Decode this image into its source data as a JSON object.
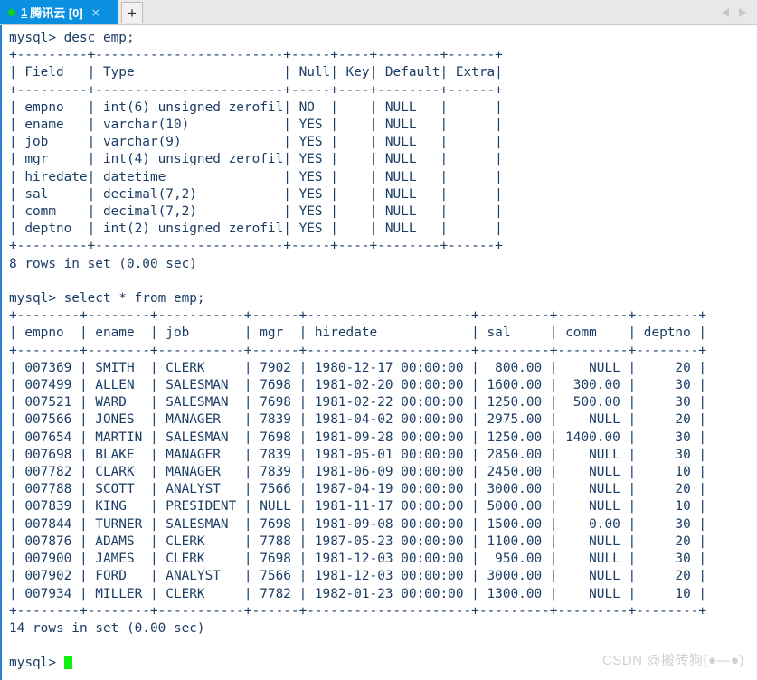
{
  "window": {
    "tab": {
      "index": "1",
      "title": "腾讯云 [0]",
      "status_dot": "green",
      "close_glyph": "×"
    },
    "new_tab_label": "+",
    "nav_prev_glyph": "◀",
    "nav_next_glyph": "▶"
  },
  "terminal": {
    "prompt": "mysql> ",
    "command_1": "desc emp;",
    "command_2": "select * from emp;",
    "final_prompt": "mysql> ",
    "result_1_footer": "8 rows in set (0.00 sec)",
    "result_2_footer": "14 rows in set (0.00 sec)",
    "desc_table": {
      "headers": [
        "Field",
        "Type",
        "Null",
        "Key",
        "Default",
        "Extra"
      ],
      "widths": [
        9,
        24,
        5,
        4,
        8,
        6
      ],
      "aligns": [
        "left",
        "left",
        "left",
        "left",
        "left",
        "left"
      ],
      "rows": [
        [
          "empno",
          "int(6) unsigned zerofill",
          "NO",
          "",
          "NULL",
          ""
        ],
        [
          "ename",
          "varchar(10)",
          "YES",
          "",
          "NULL",
          ""
        ],
        [
          "job",
          "varchar(9)",
          "YES",
          "",
          "NULL",
          ""
        ],
        [
          "mgr",
          "int(4) unsigned zerofill",
          "YES",
          "",
          "NULL",
          ""
        ],
        [
          "hiredate",
          "datetime",
          "YES",
          "",
          "NULL",
          ""
        ],
        [
          "sal",
          "decimal(7,2)",
          "YES",
          "",
          "NULL",
          ""
        ],
        [
          "comm",
          "decimal(7,2)",
          "YES",
          "",
          "NULL",
          ""
        ],
        [
          "deptno",
          "int(2) unsigned zerofill",
          "YES",
          "",
          "NULL",
          ""
        ]
      ]
    },
    "select_table": {
      "headers": [
        "empno",
        "ename",
        "job",
        "mgr",
        "hiredate",
        "sal",
        "comm",
        "deptno"
      ],
      "widths": [
        8,
        8,
        11,
        6,
        21,
        9,
        9,
        8
      ],
      "aligns": [
        "right",
        "left",
        "left",
        "right",
        "left",
        "right",
        "right",
        "right"
      ],
      "rows": [
        [
          "007369",
          "SMITH",
          "CLERK",
          "7902",
          "1980-12-17 00:00:00",
          "800.00",
          "NULL",
          "20"
        ],
        [
          "007499",
          "ALLEN",
          "SALESMAN",
          "7698",
          "1981-02-20 00:00:00",
          "1600.00",
          "300.00",
          "30"
        ],
        [
          "007521",
          "WARD",
          "SALESMAN",
          "7698",
          "1981-02-22 00:00:00",
          "1250.00",
          "500.00",
          "30"
        ],
        [
          "007566",
          "JONES",
          "MANAGER",
          "7839",
          "1981-04-02 00:00:00",
          "2975.00",
          "NULL",
          "20"
        ],
        [
          "007654",
          "MARTIN",
          "SALESMAN",
          "7698",
          "1981-09-28 00:00:00",
          "1250.00",
          "1400.00",
          "30"
        ],
        [
          "007698",
          "BLAKE",
          "MANAGER",
          "7839",
          "1981-05-01 00:00:00",
          "2850.00",
          "NULL",
          "30"
        ],
        [
          "007782",
          "CLARK",
          "MANAGER",
          "7839",
          "1981-06-09 00:00:00",
          "2450.00",
          "NULL",
          "10"
        ],
        [
          "007788",
          "SCOTT",
          "ANALYST",
          "7566",
          "1987-04-19 00:00:00",
          "3000.00",
          "NULL",
          "20"
        ],
        [
          "007839",
          "KING",
          "PRESIDENT",
          "NULL",
          "1981-11-17 00:00:00",
          "5000.00",
          "NULL",
          "10"
        ],
        [
          "007844",
          "TURNER",
          "SALESMAN",
          "7698",
          "1981-09-08 00:00:00",
          "1500.00",
          "0.00",
          "30"
        ],
        [
          "007876",
          "ADAMS",
          "CLERK",
          "7788",
          "1987-05-23 00:00:00",
          "1100.00",
          "NULL",
          "20"
        ],
        [
          "007900",
          "JAMES",
          "CLERK",
          "7698",
          "1981-12-03 00:00:00",
          "950.00",
          "NULL",
          "30"
        ],
        [
          "007902",
          "FORD",
          "ANALYST",
          "7566",
          "1981-12-03 00:00:00",
          "3000.00",
          "NULL",
          "20"
        ],
        [
          "007934",
          "MILLER",
          "CLERK",
          "7782",
          "1982-01-23 00:00:00",
          "1300.00",
          "NULL",
          "10"
        ]
      ]
    }
  },
  "watermark": "CSDN @搬砖狗(●—●)",
  "colors": {
    "tab_active": "#0b8fe0",
    "status_dot": "#12d012",
    "terminal_text": "#1b3d66",
    "terminal_bg": "#ffffff",
    "cursor": "#12f012",
    "panel_border": "#2a7fd4"
  }
}
